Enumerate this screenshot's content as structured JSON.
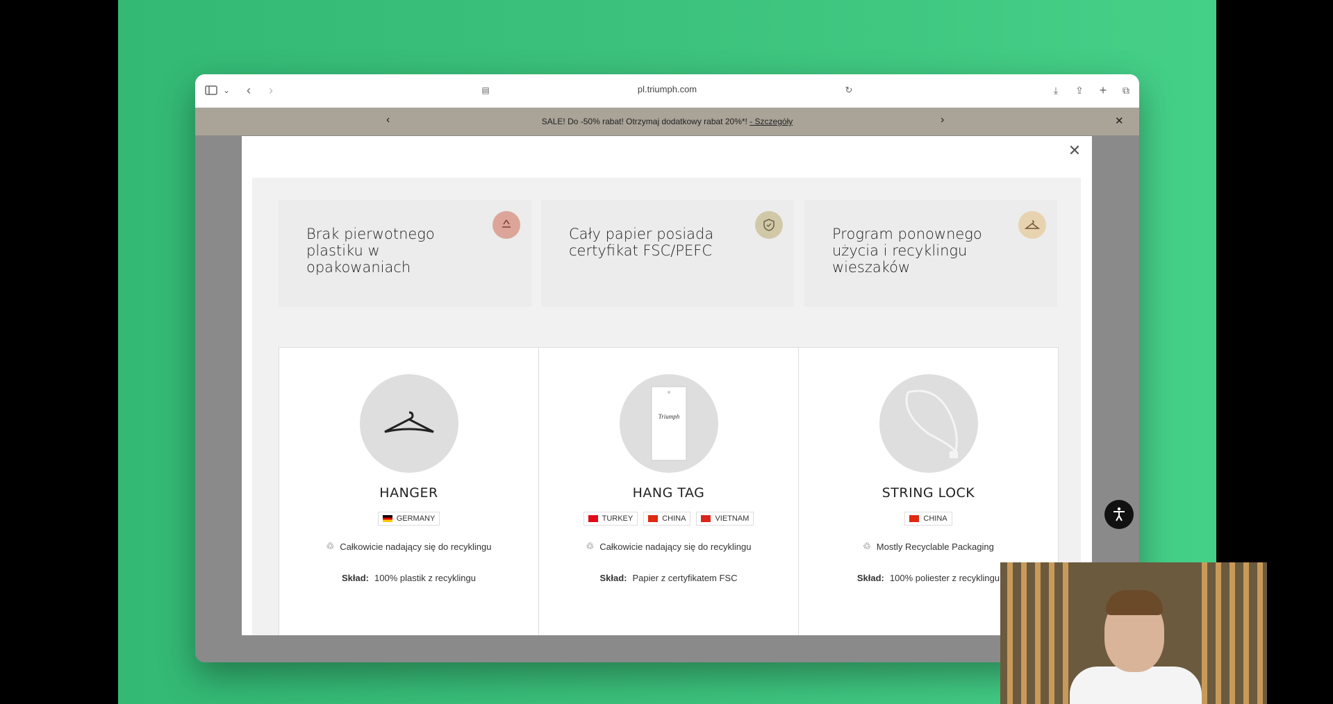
{
  "browser": {
    "url": "pl.triumph.com"
  },
  "promo": {
    "text": "SALE! Do -50% rabat! Otrzymaj dodatkowy rabat 20%*! ",
    "link": "- Szczegóły"
  },
  "features": [
    {
      "text": "Brak pierwotnego plastiku w opakowaniach",
      "icon": "recycle-icon",
      "color": "#dba699"
    },
    {
      "text": "Cały papier posiada certyfikat FSC/PEFC",
      "icon": "shield-check-icon",
      "color": "#d1c8a8"
    },
    {
      "text": "Program ponownego użycia i recyklingu wieszaków",
      "icon": "hanger-icon",
      "color": "#e8d3b0"
    }
  ],
  "products": [
    {
      "title": "HANGER",
      "countries": [
        "GERMANY"
      ],
      "recyclable": "Całkowicie nadający się do recyklingu",
      "composition_label": "Skład:",
      "composition": "100% plastik z recyklingu"
    },
    {
      "title": "HANG TAG",
      "countries": [
        "TURKEY",
        "CHINA",
        "VIETNAM"
      ],
      "recyclable": "Całkowicie nadający się do recyklingu",
      "composition_label": "Skład:",
      "composition": "Papier z certyfikatem FSC"
    },
    {
      "title": "STRING LOCK",
      "countries": [
        "CHINA"
      ],
      "recyclable": "Mostly Recyclable Packaging",
      "composition_label": "Skład:",
      "composition": "100% poliester z recyklingu"
    }
  ]
}
